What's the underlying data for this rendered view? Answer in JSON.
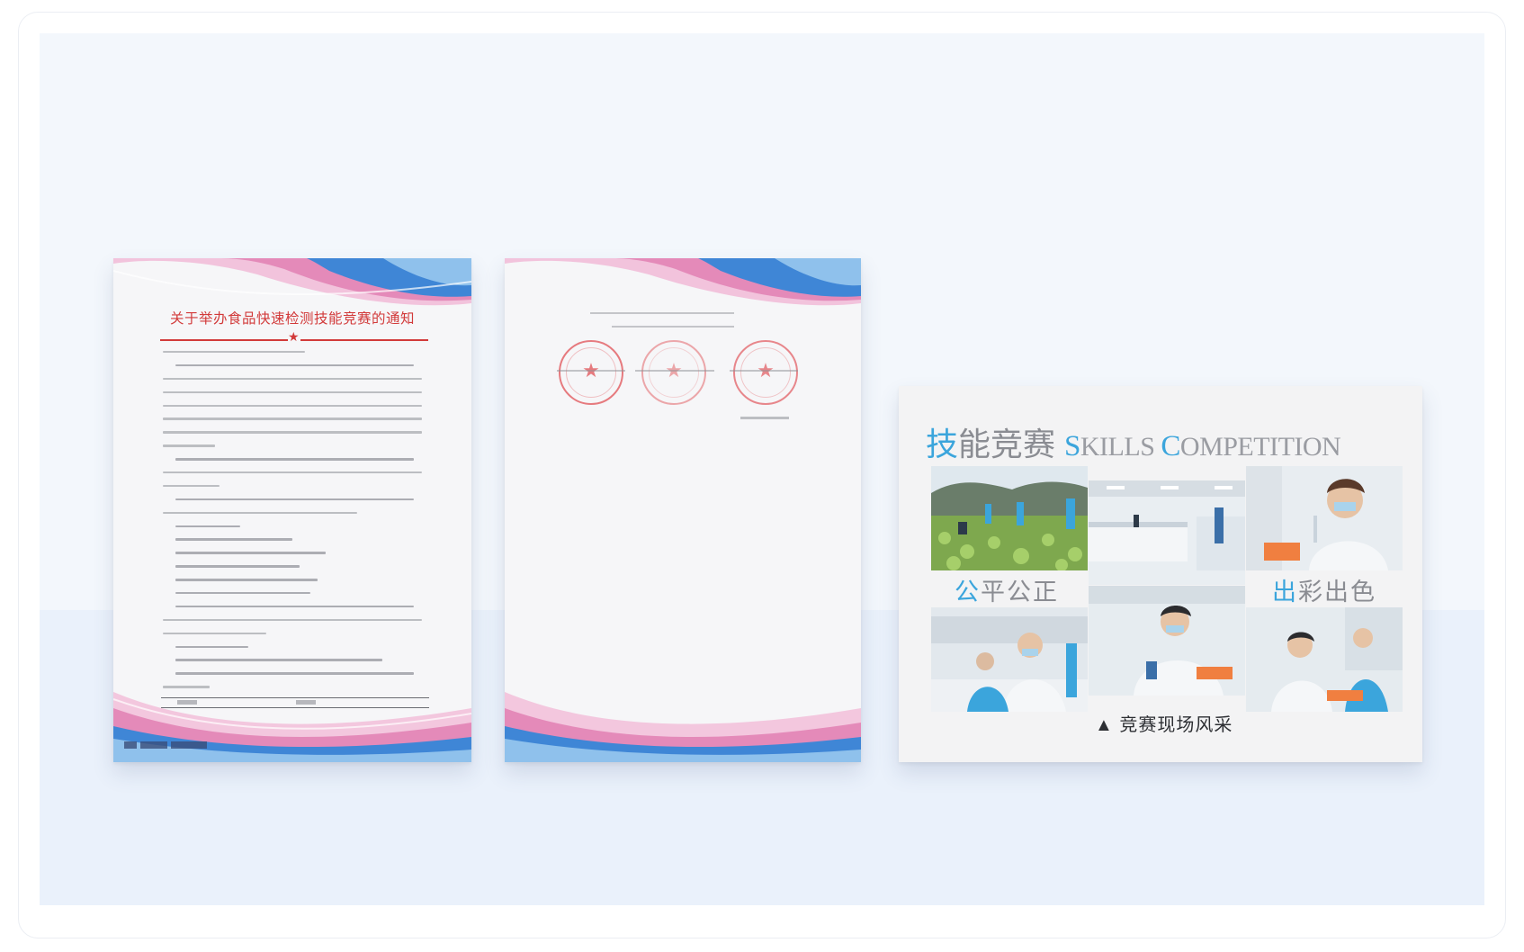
{
  "notice": {
    "title": "关于举办食品快速检测技能竞赛的通知",
    "star": "★"
  },
  "card": {
    "title_zh_highlight": "技",
    "title_zh": "能竞赛",
    "title_en_cap1": "S",
    "title_en_rest1": "KILLS ",
    "title_en_cap2": "C",
    "title_en_rest2": "OMPETITION",
    "caption_left_highlight": "公",
    "caption_left": "平公正",
    "caption_right_highlight": "出",
    "caption_right": "彩出色",
    "caption_bottom": "▲ 竞赛现场风采"
  },
  "colors": {
    "accent_blue": "#3ba5dc",
    "seal_red": "#e2585d",
    "title_red": "#d23a3a",
    "wave_pink": "#e88fc0",
    "wave_blue": "#3f86d6"
  }
}
